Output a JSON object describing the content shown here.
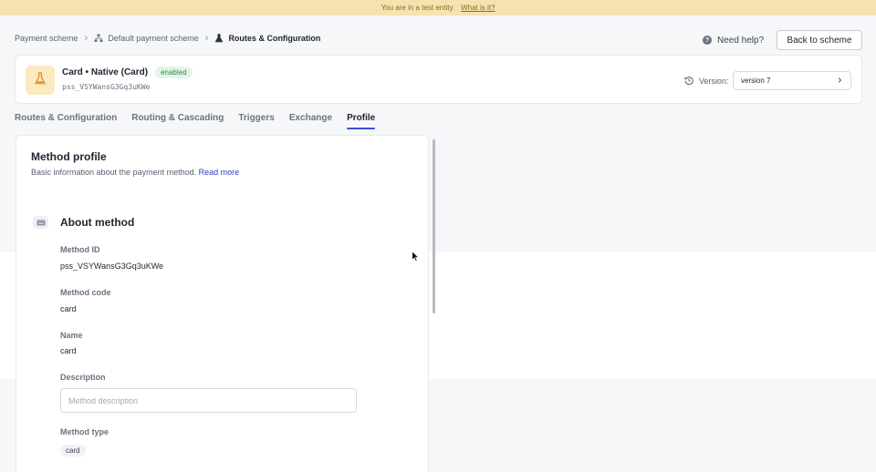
{
  "banner": {
    "text": "You are in a test entity.",
    "link": "What is it?"
  },
  "breadcrumb": {
    "items": [
      {
        "label": "Payment scheme",
        "icon": "none"
      },
      {
        "label": "Default payment scheme",
        "icon": "hierarchy-icon"
      },
      {
        "label": "Routes & Configuration",
        "icon": "flask-icon"
      }
    ]
  },
  "header": {
    "help_label": "Need help?",
    "back_label": "Back to scheme"
  },
  "method": {
    "title": "Card • Native (Card)",
    "status": "enabled",
    "id": "pss_VSYWansG3Gq3uKWe",
    "version_label": "Version:",
    "version_value": "version 7"
  },
  "tabs": [
    {
      "label": "Routes & Configuration",
      "active": false
    },
    {
      "label": "Routing & Cascading",
      "active": false
    },
    {
      "label": "Triggers",
      "active": false
    },
    {
      "label": "Exchange",
      "active": false
    },
    {
      "label": "Profile",
      "active": true
    }
  ],
  "profile": {
    "title": "Method profile",
    "subtitle": "Basic information about the payment method.",
    "read_more": "Read more",
    "section_title": "About method",
    "fields": {
      "method_id_label": "Method ID",
      "method_id_value": "pss_VSYWansG3Gq3uKWe",
      "method_code_label": "Method code",
      "method_code_value": "card",
      "name_label": "Name",
      "name_value": "card",
      "description_label": "Description",
      "description_placeholder": "Method description",
      "description_value": "",
      "method_type_label": "Method type",
      "method_type_value": "card"
    }
  },
  "colors": {
    "banner_bg": "#f6e1b0",
    "accent": "#3d4fd1",
    "link": "#2a3fc7",
    "enabled_bg": "#e3f5e8",
    "enabled_text": "#2f8a4b",
    "avatar_bg": "#fbe9c0"
  }
}
